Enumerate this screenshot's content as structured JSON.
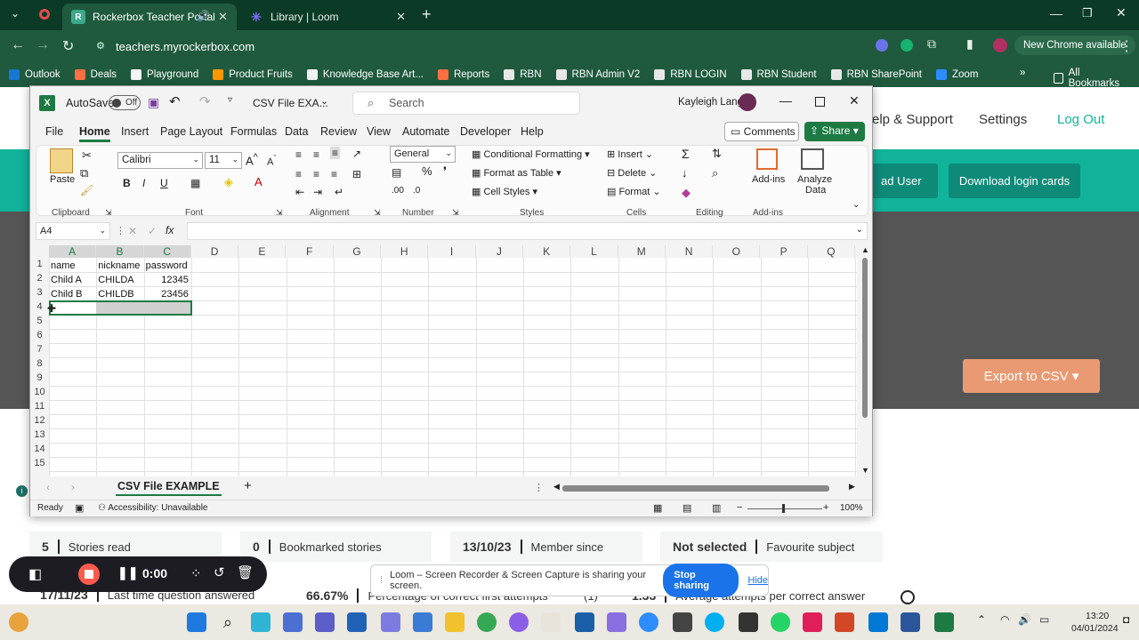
{
  "browser": {
    "tabs": [
      {
        "label": "Rockerbox Teacher Portal",
        "active": true
      },
      {
        "label": "Library | Loom",
        "active": false
      }
    ],
    "url": "teachers.myrockerbox.com",
    "chrome_badge": "New Chrome available",
    "bookmarks": [
      "Outlook",
      "Deals",
      "Playground",
      "Product Fruits",
      "Knowledge Base Art...",
      "Reports",
      "RBN",
      "RBN Admin V2",
      "RBN LOGIN",
      "RBN Student",
      "RBN SharePoint",
      "Zoom"
    ],
    "all_bookmarks": "All Bookmarks"
  },
  "webpage": {
    "nav": [
      "elp & Support",
      "Settings",
      "Log Out"
    ],
    "buttons": [
      "ad User",
      "Download login cards"
    ],
    "export_csv": "Export to CSV",
    "stats": [
      {
        "value": "5",
        "label": "Stories read"
      },
      {
        "value": "0",
        "label": "Bookmarked stories"
      },
      {
        "value": "13/10/23",
        "label": "Member since"
      },
      {
        "value": "Not selected",
        "label": "Favourite subject"
      }
    ],
    "bottom_stats": [
      {
        "value": "17/11/23",
        "label": "Last time question answered"
      },
      {
        "value": "66.67%",
        "label": "Percentage of correct first attempts"
      },
      {
        "value": "1.33",
        "label": "Average attempts per correct answer"
      }
    ],
    "bottom_count": "(1)"
  },
  "excel": {
    "autosave_label": "AutoSave",
    "autosave_state": "Off",
    "filename": "CSV File EXA...",
    "search_placeholder": "Search",
    "user": "Kayleigh Lang",
    "menu": [
      "File",
      "Home",
      "Insert",
      "Page Layout",
      "Formulas",
      "Data",
      "Review",
      "View",
      "Automate",
      "Developer",
      "Help"
    ],
    "comments": "Comments",
    "share": "Share",
    "ribbon": {
      "paste": "Paste",
      "clipboard": "Clipboard",
      "font_name": "Calibri",
      "font_size": "11",
      "font": "Font",
      "alignment": "Alignment",
      "number_format": "General",
      "number": "Number",
      "conditional": "Conditional Formatting",
      "format_table": "Format as Table",
      "cell_styles": "Cell Styles",
      "styles": "Styles",
      "insert": "Insert",
      "delete": "Delete",
      "format": "Format",
      "cells": "Cells",
      "editing": "Editing",
      "addins": "Add-ins",
      "addins_group": "Add-ins",
      "analyze": "Analyze",
      "analyze2": "Data"
    },
    "name_box": "A4",
    "columns": [
      "A",
      "B",
      "C",
      "D",
      "E",
      "F",
      "G",
      "H",
      "I",
      "J",
      "K",
      "L",
      "M",
      "N",
      "O",
      "P",
      "Q"
    ],
    "rows": [
      "1",
      "2",
      "3",
      "4",
      "5",
      "6",
      "7",
      "8",
      "9",
      "10",
      "11",
      "12",
      "13",
      "14",
      "15"
    ],
    "cells": [
      [
        "name",
        "nickname",
        "password"
      ],
      [
        "Child A",
        "CHILDA",
        "12345"
      ],
      [
        "Child B",
        "CHILDB",
        "23456"
      ]
    ],
    "sheet_tab": "CSV File EXAMPLE",
    "status_ready": "Ready",
    "accessibility": "Accessibility: Unavailable",
    "zoom": "100%"
  },
  "loom": {
    "timer": "0:00",
    "share_msg": "Loom – Screen Recorder & Screen Capture is sharing your screen.",
    "stop": "Stop sharing",
    "hide": "Hide"
  },
  "taskbar": {
    "time": "13:20",
    "date": "04/01/2024"
  }
}
